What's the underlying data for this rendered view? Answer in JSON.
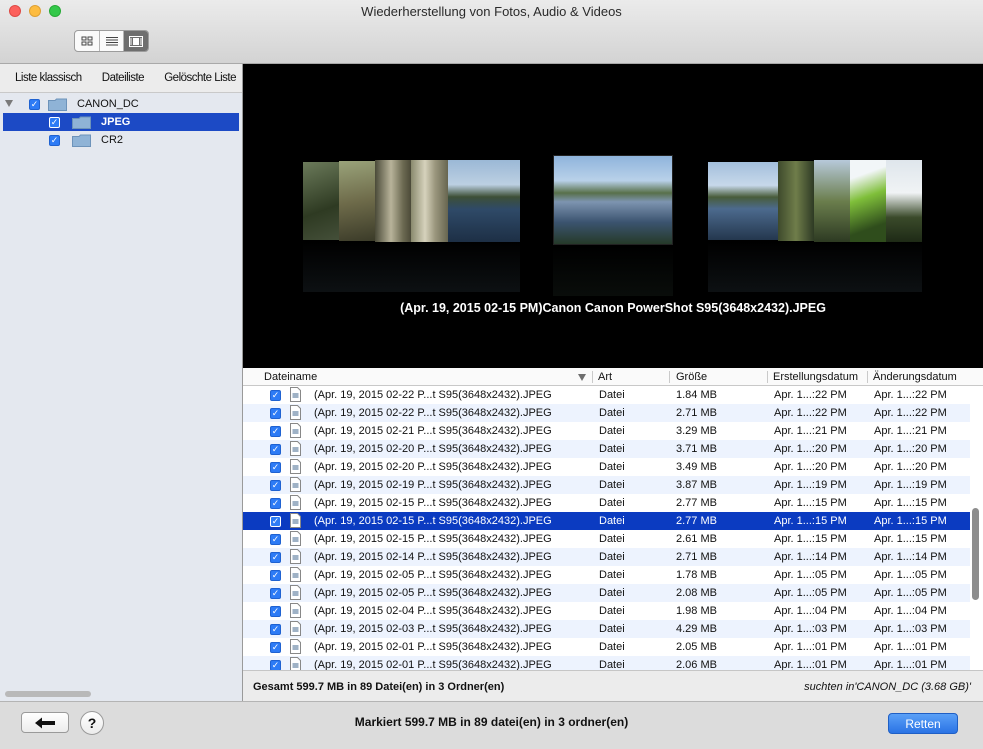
{
  "window": {
    "title": "Wiederherstellung von Fotos, Audio & Videos"
  },
  "toolbar": {
    "view_modes": [
      "grid-view-icon",
      "list-view-icon",
      "coverflow-view-icon"
    ],
    "active_view": "coverflow-view-icon"
  },
  "sidebar": {
    "tabs": [
      "Liste klassisch",
      "Dateiliste",
      "Gelöschte Liste"
    ],
    "tree": [
      {
        "label": "CANON_DC",
        "checked": true,
        "level": 0,
        "expanded": true,
        "selected": false
      },
      {
        "label": "JPEG",
        "checked": true,
        "level": 1,
        "selected": true
      },
      {
        "label": "CR2",
        "checked": true,
        "level": 1,
        "selected": false
      }
    ]
  },
  "preview": {
    "caption": "(Apr. 19, 2015 02-15 PM)Canon Canon PowerShot S95(3648x2432).JPEG"
  },
  "table": {
    "columns": [
      "Dateiname",
      "Art",
      "Größe",
      "Erstellungsdatum",
      "Änderungsdatum"
    ],
    "sorted_column": "Dateiname",
    "rows": [
      {
        "name": "(Apr. 19, 2015 02-22 P...t S95(3648x2432).JPEG",
        "art": "Datei",
        "size": "1.84 MB",
        "created": "Apr. 1...:22 PM",
        "modified": "Apr. 1...:22 PM",
        "checked": true,
        "selected": false
      },
      {
        "name": "(Apr. 19, 2015 02-22 P...t S95(3648x2432).JPEG",
        "art": "Datei",
        "size": "2.71 MB",
        "created": "Apr. 1...:22 PM",
        "modified": "Apr. 1...:22 PM",
        "checked": true,
        "selected": false
      },
      {
        "name": "(Apr. 19, 2015 02-21 P...t S95(3648x2432).JPEG",
        "art": "Datei",
        "size": "3.29 MB",
        "created": "Apr. 1...:21 PM",
        "modified": "Apr. 1...:21 PM",
        "checked": true,
        "selected": false
      },
      {
        "name": "(Apr. 19, 2015 02-20 P...t S95(3648x2432).JPEG",
        "art": "Datei",
        "size": "3.71 MB",
        "created": "Apr. 1...:20 PM",
        "modified": "Apr. 1...:20 PM",
        "checked": true,
        "selected": false
      },
      {
        "name": "(Apr. 19, 2015 02-20 P...t S95(3648x2432).JPEG",
        "art": "Datei",
        "size": "3.49 MB",
        "created": "Apr. 1...:20 PM",
        "modified": "Apr. 1...:20 PM",
        "checked": true,
        "selected": false
      },
      {
        "name": "(Apr. 19, 2015 02-19 P...t S95(3648x2432).JPEG",
        "art": "Datei",
        "size": "3.87 MB",
        "created": "Apr. 1...:19 PM",
        "modified": "Apr. 1...:19 PM",
        "checked": true,
        "selected": false
      },
      {
        "name": "(Apr. 19, 2015 02-15 P...t S95(3648x2432).JPEG",
        "art": "Datei",
        "size": "2.77 MB",
        "created": "Apr. 1...:15 PM",
        "modified": "Apr. 1...:15 PM",
        "checked": true,
        "selected": false
      },
      {
        "name": "(Apr. 19, 2015 02-15 P...t S95(3648x2432).JPEG",
        "art": "Datei",
        "size": "2.77 MB",
        "created": "Apr. 1...:15 PM",
        "modified": "Apr. 1...:15 PM",
        "checked": true,
        "selected": true
      },
      {
        "name": "(Apr. 19, 2015 02-15 P...t S95(3648x2432).JPEG",
        "art": "Datei",
        "size": "2.61 MB",
        "created": "Apr. 1...:15 PM",
        "modified": "Apr. 1...:15 PM",
        "checked": true,
        "selected": false
      },
      {
        "name": "(Apr. 19, 2015 02-14 P...t S95(3648x2432).JPEG",
        "art": "Datei",
        "size": "2.71 MB",
        "created": "Apr. 1...:14 PM",
        "modified": "Apr. 1...:14 PM",
        "checked": true,
        "selected": false
      },
      {
        "name": "(Apr. 19, 2015 02-05 P...t S95(3648x2432).JPEG",
        "art": "Datei",
        "size": "1.78 MB",
        "created": "Apr. 1...:05 PM",
        "modified": "Apr. 1...:05 PM",
        "checked": true,
        "selected": false
      },
      {
        "name": "(Apr. 19, 2015 02-05 P...t S95(3648x2432).JPEG",
        "art": "Datei",
        "size": "2.08 MB",
        "created": "Apr. 1...:05 PM",
        "modified": "Apr. 1...:05 PM",
        "checked": true,
        "selected": false
      },
      {
        "name": "(Apr. 19, 2015 02-04 P...t S95(3648x2432).JPEG",
        "art": "Datei",
        "size": "1.98 MB",
        "created": "Apr. 1...:04 PM",
        "modified": "Apr. 1...:04 PM",
        "checked": true,
        "selected": false
      },
      {
        "name": "(Apr. 19, 2015 02-03 P...t S95(3648x2432).JPEG",
        "art": "Datei",
        "size": "4.29 MB",
        "created": "Apr. 1...:03 PM",
        "modified": "Apr. 1...:03 PM",
        "checked": true,
        "selected": false
      },
      {
        "name": "(Apr. 19, 2015 02-01 P...t S95(3648x2432).JPEG",
        "art": "Datei",
        "size": "2.05 MB",
        "created": "Apr. 1...:01 PM",
        "modified": "Apr. 1...:01 PM",
        "checked": true,
        "selected": false
      },
      {
        "name": "(Apr. 19, 2015 02-01 P...t S95(3648x2432).JPEG",
        "art": "Datei",
        "size": "2.06 MB",
        "created": "Apr. 1...:01 PM",
        "modified": "Apr. 1...:01 PM",
        "checked": true,
        "selected": false
      }
    ]
  },
  "status": {
    "total": "Gesamt 599.7 MB in 89 Datei(en) in 3 Ordner(en)",
    "search_scope": "suchten in'CANON_DC (3.68 GB)'"
  },
  "footer": {
    "back_icon": "arrow-left-icon",
    "help_label": "?",
    "marked_summary": "Markiert 599.7 MB in 89 datei(en) in 3 ordner(en)",
    "recover_label": "Retten"
  },
  "colors": {
    "selection": "#0b3bc1",
    "sidebar_selection": "#1c4ac5",
    "checkbox": "#2d7bf5",
    "primary_button": "#2a73e5",
    "alt_row": "#edf3fe"
  }
}
